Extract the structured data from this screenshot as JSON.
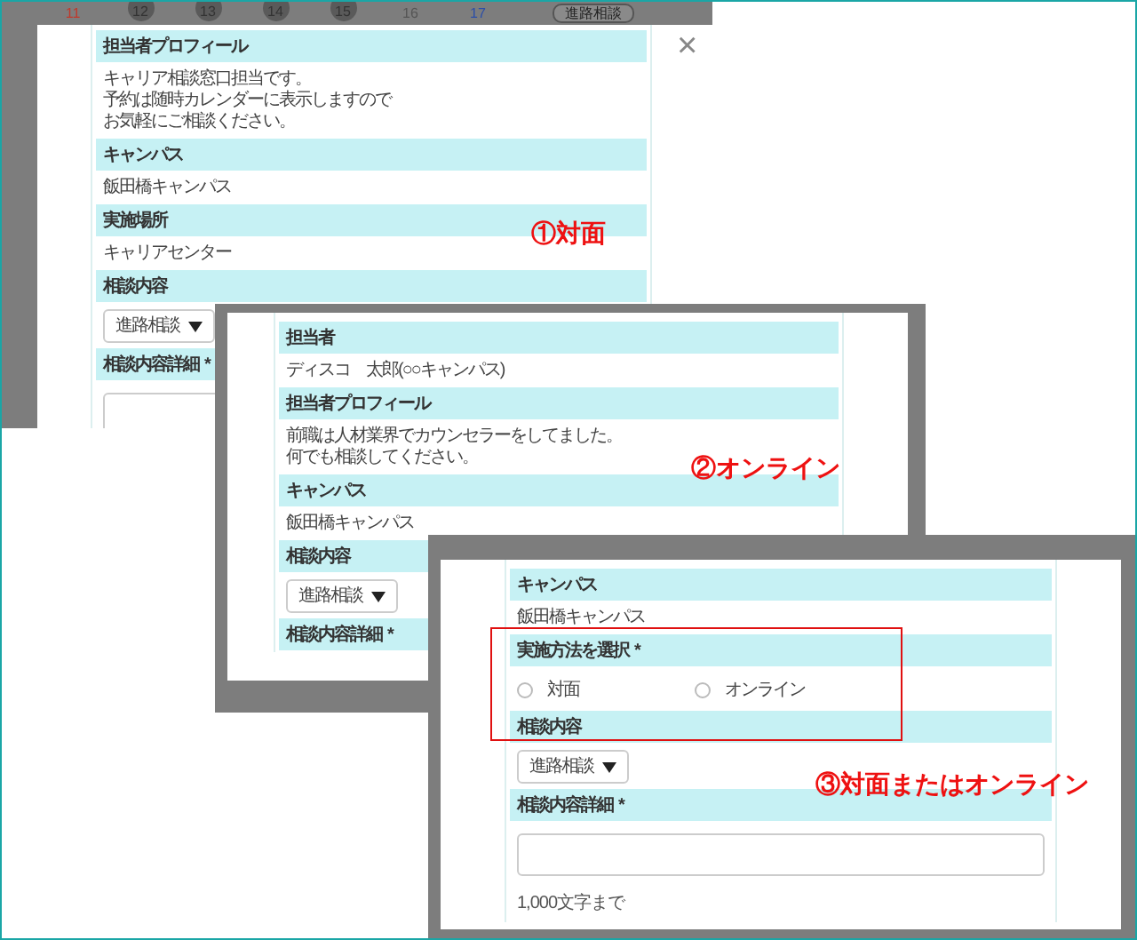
{
  "panels": [
    {
      "label": "①対面",
      "close": "×",
      "top_button": "進路相談",
      "calendar": [
        {
          "day": "11",
          "color": "#c0392b",
          "circled": false
        },
        {
          "day": "12",
          "color": "#333333",
          "circled": true
        },
        {
          "day": "13",
          "color": "#333333",
          "circled": true
        },
        {
          "day": "14",
          "color": "#333333",
          "circled": true
        },
        {
          "day": "15",
          "color": "#333333",
          "circled": true
        },
        {
          "day": "16",
          "color": "#555555",
          "circled": false
        },
        {
          "day": "17",
          "color": "#2c4fa8",
          "circled": false
        }
      ],
      "sections": [
        {
          "kind": "header",
          "text": "担当者プロフィール"
        },
        {
          "kind": "text",
          "lines": [
            "キャリア相談窓口担当です。",
            "予約は随時カレンダーに表示しますので",
            "お気軽にご相談ください。"
          ]
        },
        {
          "kind": "header",
          "text": "キャンパス"
        },
        {
          "kind": "text",
          "lines": [
            "飯田橋キャンパス"
          ]
        },
        {
          "kind": "header",
          "text": "実施場所"
        },
        {
          "kind": "text",
          "lines": [
            "キャリアセンター"
          ]
        },
        {
          "kind": "header",
          "text": "相談内容"
        },
        {
          "kind": "select",
          "value": "進路相談"
        },
        {
          "kind": "header",
          "text": "相談内容詳細",
          "required_mark": "*"
        },
        {
          "kind": "textarea"
        }
      ]
    },
    {
      "label": "②オンライン",
      "sections": [
        {
          "kind": "header",
          "text": "担当者"
        },
        {
          "kind": "text",
          "lines": [
            "ディスコ　太郎(○○キャンパス)"
          ]
        },
        {
          "kind": "header",
          "text": "担当者プロフィール"
        },
        {
          "kind": "text",
          "lines": [
            "前職は人材業界でカウンセラーをしてました。",
            "何でも相談してください。"
          ]
        },
        {
          "kind": "header",
          "text": "キャンパス"
        },
        {
          "kind": "text",
          "lines": [
            "飯田橋キャンパス"
          ]
        },
        {
          "kind": "header",
          "text": "相談内容"
        },
        {
          "kind": "select",
          "value": "進路相談"
        },
        {
          "kind": "header",
          "text": "相談内容詳細",
          "required_mark": "*"
        }
      ]
    },
    {
      "label": "③対面またはオンライン",
      "highlight": true,
      "sections": [
        {
          "kind": "header",
          "text": "キャンパス"
        },
        {
          "kind": "text",
          "lines": [
            "飯田橋キャンパス"
          ]
        },
        {
          "kind": "header",
          "text": "実施方法を選択",
          "required_mark": "*"
        },
        {
          "kind": "radios",
          "options": [
            {
              "label": "対面",
              "selected": false
            },
            {
              "label": "オンライン",
              "selected": false
            }
          ]
        },
        {
          "kind": "header",
          "text": "相談内容"
        },
        {
          "kind": "select",
          "value": "進路相談"
        },
        {
          "kind": "header",
          "text": "相談内容詳細",
          "required_mark": "*"
        },
        {
          "kind": "textarea"
        },
        {
          "kind": "note",
          "text": "1,000文字まで"
        }
      ]
    }
  ]
}
